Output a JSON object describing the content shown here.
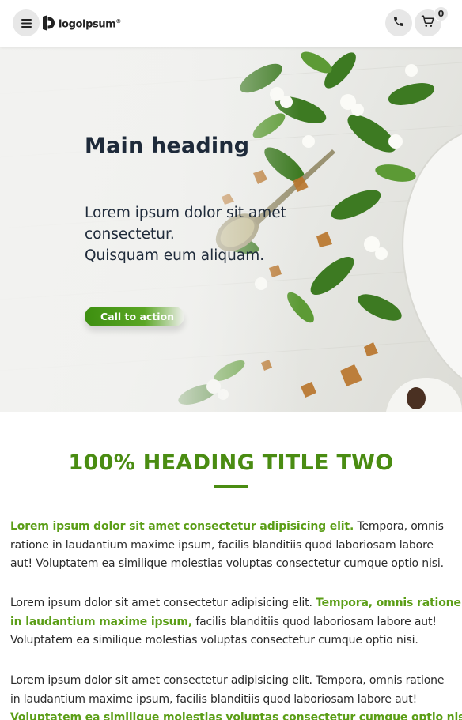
{
  "header": {
    "logo_text": "logoipsum",
    "logo_mark": "®",
    "cart_count": "0",
    "icons": {
      "menu": "hamburger-menu-icon",
      "phone": "phone-icon",
      "cart": "shopping-cart-icon"
    }
  },
  "hero": {
    "title": "Main heading",
    "lead_lines": [
      "Lorem ipsum dolor sit amet",
      "consectetur.",
      "Quisquam eum aliquam."
    ],
    "cta_label": "Call to action"
  },
  "section": {
    "title": "100% HEADING TITLE TWO",
    "accent_color": "#4a8c12"
  },
  "paragraphs": {
    "p1": {
      "highlight": "Lorem ipsum dolor sit amet consectetur adipisicing elit.",
      "line1_rest": " Tempora, omnis",
      "line2": "ratione in laudantium maxime ipsum, facilis blanditiis quod laboriosam labore",
      "line3": "aut! Voluptatem ea similique molestias voluptas consectetur cumque optio nisi."
    },
    "p2": {
      "line1_plain": "Lorem ipsum dolor sit amet consectetur adipisicing elit. ",
      "line1_highlight": "Tempora, omnis ratione",
      "line2_highlight": "in laudantium maxime ipsum,",
      "line2_rest": " facilis blanditiis quod laboriosam labore aut!",
      "line3": "Voluptatem ea similique molestias voluptas consectetur cumque optio nisi."
    },
    "p3": {
      "line1": "Lorem ipsum dolor sit amet consectetur adipisicing elit. Tempora, omnis ratione",
      "line2": "in laudantium maxime ipsum, facilis blanditiis quod laboriosam labore aut!",
      "line3_highlight": "Voluptatem ea similique molestias voluptas consectetur cumque optio nisi."
    }
  }
}
